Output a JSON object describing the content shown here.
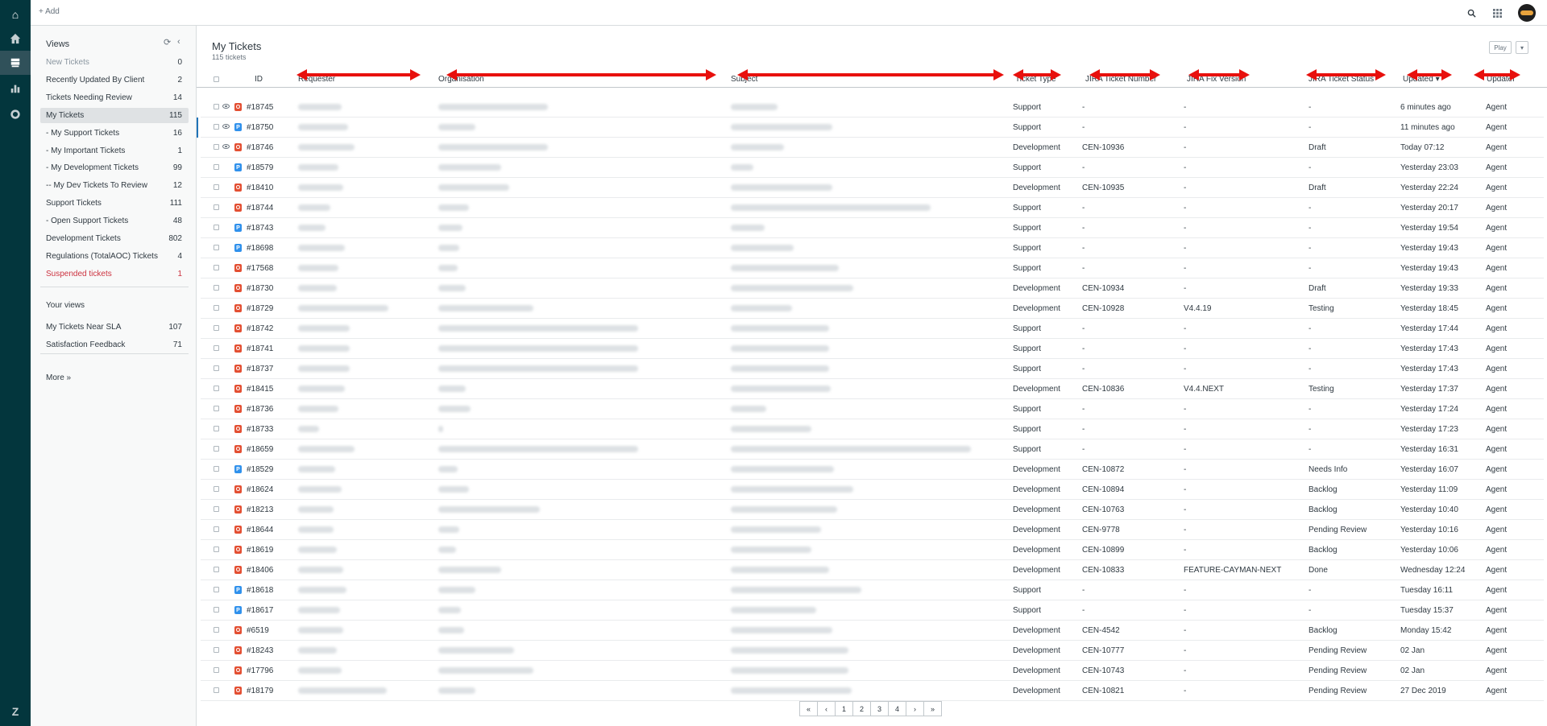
{
  "topbar": {
    "add_label": "+ Add"
  },
  "views": {
    "heading": "Views",
    "items": [
      {
        "label": "New Tickets",
        "count": "0",
        "style": "highlight"
      },
      {
        "label": "Recently Updated By Client",
        "count": "2"
      },
      {
        "label": "Tickets Needing Review",
        "count": "14"
      },
      {
        "label": "My Tickets",
        "count": "115",
        "style": "active"
      },
      {
        "label": "- My Support Tickets",
        "count": "16"
      },
      {
        "label": "- My Important Tickets",
        "count": "1"
      },
      {
        "label": "- My Development Tickets",
        "count": "99"
      },
      {
        "label": "-- My Dev Tickets To Review",
        "count": "12"
      },
      {
        "label": "Support Tickets",
        "count": "111"
      },
      {
        "label": "- Open Support Tickets",
        "count": "48"
      },
      {
        "label": "Development Tickets",
        "count": "802"
      },
      {
        "label": "Regulations (TotalAOC) Tickets",
        "count": "4"
      },
      {
        "label": "Suspended tickets",
        "count": "1",
        "style": "danger"
      }
    ],
    "your_views_heading": "Your views",
    "your_views": [
      {
        "label": "My Tickets Near SLA",
        "count": "107"
      },
      {
        "label": "Satisfaction Feedback",
        "count": "71"
      }
    ],
    "more_label": "More »"
  },
  "main": {
    "title": "My Tickets",
    "subtitle": "115 tickets",
    "play_label": "Play",
    "columns": {
      "id": "ID",
      "requester": "Requester",
      "organisation": "Organisation",
      "subject": "Subject",
      "ticket_type": "Ticket Type",
      "jira_number": "JIRA Ticket Number",
      "jira_fix": "JIRA Fix Version",
      "jira_status": "JIRA Ticket Status",
      "updated": "Updated ▾",
      "updater": "Updater"
    },
    "rows": [
      {
        "eye": true,
        "badge": "O",
        "id": "#18745",
        "type": "Support",
        "jira": "-",
        "fix": "-",
        "status": "-",
        "updated": "6 minutes ago",
        "updater": "Agent"
      },
      {
        "eye": true,
        "badge": "P",
        "id": "#18750",
        "type": "Support",
        "jira": "-",
        "fix": "-",
        "status": "-",
        "updated": "11 minutes ago",
        "updater": "Agent",
        "selected": true
      },
      {
        "eye": true,
        "badge": "O",
        "id": "#18746",
        "type": "Development",
        "jira": "CEN-10936",
        "fix": "-",
        "status": "Draft",
        "updated": "Today 07:12",
        "updater": "Agent"
      },
      {
        "badge": "P",
        "id": "#18579",
        "type": "Support",
        "jira": "-",
        "fix": "-",
        "status": "-",
        "updated": "Yesterday 23:03",
        "updater": "Agent"
      },
      {
        "badge": "O",
        "id": "#18410",
        "type": "Development",
        "jira": "CEN-10935",
        "fix": "-",
        "status": "Draft",
        "updated": "Yesterday 22:24",
        "updater": "Agent"
      },
      {
        "badge": "O",
        "id": "#18744",
        "type": "Support",
        "jira": "-",
        "fix": "-",
        "status": "-",
        "updated": "Yesterday 20:17",
        "updater": "Agent"
      },
      {
        "badge": "P",
        "id": "#18743",
        "type": "Support",
        "jira": "-",
        "fix": "-",
        "status": "-",
        "updated": "Yesterday 19:54",
        "updater": "Agent"
      },
      {
        "badge": "P",
        "id": "#18698",
        "type": "Support",
        "jira": "-",
        "fix": "-",
        "status": "-",
        "updated": "Yesterday 19:43",
        "updater": "Agent"
      },
      {
        "badge": "O",
        "id": "#17568",
        "type": "Support",
        "jira": "-",
        "fix": "-",
        "status": "-",
        "updated": "Yesterday 19:43",
        "updater": "Agent"
      },
      {
        "badge": "O",
        "id": "#18730",
        "type": "Development",
        "jira": "CEN-10934",
        "fix": "-",
        "status": "Draft",
        "updated": "Yesterday 19:33",
        "updater": "Agent"
      },
      {
        "badge": "O",
        "id": "#18729",
        "type": "Development",
        "jira": "CEN-10928",
        "fix": "V4.4.19",
        "status": "Testing",
        "updated": "Yesterday 18:45",
        "updater": "Agent"
      },
      {
        "badge": "O",
        "id": "#18742",
        "type": "Support",
        "jira": "-",
        "fix": "-",
        "status": "-",
        "updated": "Yesterday 17:44",
        "updater": "Agent"
      },
      {
        "badge": "O",
        "id": "#18741",
        "type": "Support",
        "jira": "-",
        "fix": "-",
        "status": "-",
        "updated": "Yesterday 17:43",
        "updater": "Agent"
      },
      {
        "badge": "O",
        "id": "#18737",
        "type": "Support",
        "jira": "-",
        "fix": "-",
        "status": "-",
        "updated": "Yesterday 17:43",
        "updater": "Agent"
      },
      {
        "badge": "O",
        "id": "#18415",
        "type": "Development",
        "jira": "CEN-10836",
        "fix": "V4.4.NEXT",
        "status": "Testing",
        "updated": "Yesterday 17:37",
        "updater": "Agent"
      },
      {
        "badge": "O",
        "id": "#18736",
        "type": "Support",
        "jira": "-",
        "fix": "-",
        "status": "-",
        "updated": "Yesterday 17:24",
        "updater": "Agent"
      },
      {
        "badge": "O",
        "id": "#18733",
        "type": "Support",
        "jira": "-",
        "fix": "-",
        "status": "-",
        "updated": "Yesterday 17:23",
        "updater": "Agent"
      },
      {
        "badge": "O",
        "id": "#18659",
        "type": "Support",
        "jira": "-",
        "fix": "-",
        "status": "-",
        "updated": "Yesterday 16:31",
        "updater": "Agent"
      },
      {
        "badge": "P",
        "id": "#18529",
        "type": "Development",
        "jira": "CEN-10872",
        "fix": "-",
        "status": "Needs Info",
        "updated": "Yesterday 16:07",
        "updater": "Agent"
      },
      {
        "badge": "O",
        "id": "#18624",
        "type": "Development",
        "jira": "CEN-10894",
        "fix": "-",
        "status": "Backlog",
        "updated": "Yesterday 11:09",
        "updater": "Agent"
      },
      {
        "badge": "O",
        "id": "#18213",
        "type": "Development",
        "jira": "CEN-10763",
        "fix": "-",
        "status": "Backlog",
        "updated": "Yesterday 10:40",
        "updater": "Agent"
      },
      {
        "badge": "O",
        "id": "#18644",
        "type": "Development",
        "jira": "CEN-9778",
        "fix": "-",
        "status": "Pending Review",
        "updated": "Yesterday 10:16",
        "updater": "Agent"
      },
      {
        "badge": "O",
        "id": "#18619",
        "type": "Development",
        "jira": "CEN-10899",
        "fix": "-",
        "status": "Backlog",
        "updated": "Yesterday 10:06",
        "updater": "Agent"
      },
      {
        "badge": "O",
        "id": "#18406",
        "type": "Development",
        "jira": "CEN-10833",
        "fix": "FEATURE-CAYMAN-NEXT",
        "status": "Done",
        "updated": "Wednesday 12:24",
        "updater": "Agent"
      },
      {
        "badge": "P",
        "id": "#18618",
        "type": "Support",
        "jira": "-",
        "fix": "-",
        "status": "-",
        "updated": "Tuesday 16:11",
        "updater": "Agent"
      },
      {
        "badge": "P",
        "id": "#18617",
        "type": "Support",
        "jira": "-",
        "fix": "-",
        "status": "-",
        "updated": "Tuesday 15:37",
        "updater": "Agent"
      },
      {
        "badge": "O",
        "id": "#6519",
        "type": "Development",
        "jira": "CEN-4542",
        "fix": "-",
        "status": "Backlog",
        "updated": "Monday 15:42",
        "updater": "Agent"
      },
      {
        "badge": "O",
        "id": "#18243",
        "type": "Development",
        "jira": "CEN-10777",
        "fix": "-",
        "status": "Pending Review",
        "updated": "02 Jan",
        "updater": "Agent"
      },
      {
        "badge": "O",
        "id": "#17796",
        "type": "Development",
        "jira": "CEN-10743",
        "fix": "-",
        "status": "Pending Review",
        "updated": "02 Jan",
        "updater": "Agent"
      },
      {
        "badge": "O",
        "id": "#18179",
        "type": "Development",
        "jira": "CEN-10821",
        "fix": "-",
        "status": "Pending Review",
        "updated": "27 Dec 2019",
        "updater": "Agent"
      }
    ]
  },
  "pagination": [
    "«",
    "‹",
    "1",
    "2",
    "3",
    "4",
    "›",
    "»"
  ],
  "colors": {
    "rail": "#03363d",
    "badge_open": "#e34f32",
    "badge_pending": "#3091ec",
    "annotation_arrow": "#e8100d"
  }
}
